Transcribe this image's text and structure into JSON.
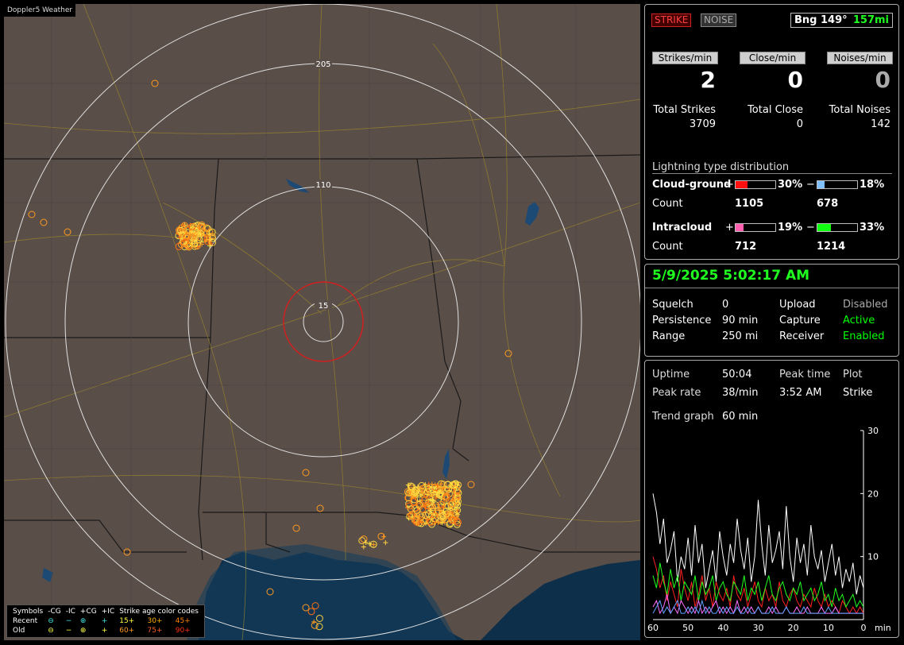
{
  "app": {
    "title": "Doppler5 Weather"
  },
  "map": {
    "ring_labels": [
      "205",
      "110",
      "15"
    ],
    "legend": {
      "symbols_label": "Symbols",
      "headers": [
        "-CG",
        "-IC",
        "+CG",
        "+IC"
      ],
      "age_label": "Strike age color codes",
      "recent_label": "Recent",
      "old_label": "Old",
      "recent_symbols": [
        "⊖",
        "−",
        "⊕",
        "+"
      ],
      "old_symbols": [
        "⊖",
        "−",
        "⊕",
        "+"
      ],
      "recent_ages": [
        "15+",
        "30+",
        "45+"
      ],
      "old_ages": [
        "60+",
        "75+",
        "90+"
      ],
      "age_colors": [
        "#ffff40",
        "#ffb000",
        "#ff8000"
      ]
    },
    "colors": {
      "land": "#5a4e48",
      "water": "#0e2f4a",
      "rings": "#e0e0e0",
      "close_ring": "#d02020",
      "roads": "#a08a2a",
      "borders": "#1a1a1a",
      "strike_orange": "#ff9a20",
      "strike_yellow": "#ffe040"
    }
  },
  "status": {
    "strike_btn": "STRIKE",
    "noise_btn": "NOISE",
    "bearing": "Bng 149°",
    "distance": "157mi",
    "headers": {
      "strikes": "Strikes/min",
      "close": "Close/min",
      "noises": "Noises/min"
    },
    "rates": {
      "strikes": "2",
      "close": "0",
      "noises": "0"
    },
    "totals_labels": {
      "strikes": "Total Strikes",
      "close": "Total Close",
      "noises": "Total Noises"
    },
    "totals": {
      "strikes": "3709",
      "close": "0",
      "noises": "142"
    }
  },
  "distribution": {
    "title": "Lightning type distribution",
    "cg_label": "Cloud-ground",
    "ic_label": "Intracloud",
    "count_label": "Count",
    "plus": "+",
    "minus": "−",
    "cg_pos_pct": "30%",
    "cg_neg_pct": "18%",
    "ic_pos_pct": "19%",
    "ic_neg_pct": "33%",
    "cg_pos_fraction": 0.3,
    "cg_neg_fraction": 0.18,
    "ic_pos_fraction": 0.19,
    "ic_neg_fraction": 0.33,
    "cg_pos_count": "1105",
    "cg_neg_count": "678",
    "ic_pos_count": "712",
    "ic_neg_count": "1214",
    "colors": {
      "cg_pos": "#ff1010",
      "cg_neg": "#80c0ff",
      "ic_pos": "#ff60b0",
      "ic_neg": "#10ff10"
    }
  },
  "settings": {
    "datetime": "5/9/2025 5:02:17 AM",
    "squelch_label": "Squelch",
    "squelch": "0",
    "persistence_label": "Persistence",
    "persistence": "90 min",
    "range_label": "Range",
    "range": "250 mi",
    "upload_label": "Upload",
    "upload": "Disabled",
    "capture_label": "Capture",
    "capture": "Active",
    "receiver_label": "Receiver",
    "receiver": "Enabled"
  },
  "stats": {
    "uptime_label": "Uptime",
    "uptime": "50:04",
    "peak_time_label": "Peak time",
    "peak_time": "3:52 AM",
    "plot_label": "Plot",
    "plot": "Strike",
    "peak_rate_label": "Peak rate",
    "peak_rate": "38/min",
    "trend_label": "Trend graph",
    "trend": "60 min"
  },
  "chart_data": {
    "type": "line",
    "x_ticks": [
      "60",
      "50",
      "40",
      "30",
      "20",
      "10",
      "0"
    ],
    "x_unit": "min",
    "y_ticks": [
      "30",
      "20",
      "10"
    ],
    "ylim": [
      0,
      30
    ],
    "xlim": [
      60,
      0
    ],
    "series": [
      {
        "color": "#ffffff",
        "values": [
          20,
          17,
          12,
          16,
          9,
          11,
          14,
          6,
          10,
          8,
          13,
          7,
          15,
          9,
          12,
          5,
          8,
          11,
          6,
          14,
          10,
          7,
          12,
          9,
          16,
          11,
          8,
          13,
          6,
          10,
          19,
          12,
          7,
          15,
          9,
          11,
          14,
          8,
          18,
          10,
          6,
          13,
          9,
          12,
          7,
          15,
          10,
          8,
          11,
          6,
          9,
          12,
          7,
          10,
          5,
          8,
          6,
          9,
          4,
          7,
          5
        ]
      },
      {
        "color": "#ff2020",
        "values": [
          10,
          8,
          5,
          7,
          3,
          6,
          4,
          2,
          8,
          5,
          3,
          6,
          2,
          4,
          7,
          3,
          5,
          2,
          6,
          4,
          3,
          5,
          2,
          7,
          4,
          3,
          5,
          2,
          4,
          6,
          3,
          2,
          5,
          3,
          4,
          2,
          6,
          3,
          2,
          4,
          5,
          3,
          2,
          4,
          3,
          2,
          5,
          3,
          2,
          4,
          2,
          3,
          2,
          1,
          3,
          2,
          1,
          2,
          1,
          2,
          1
        ]
      },
      {
        "color": "#20ff20",
        "values": [
          7,
          5,
          9,
          6,
          4,
          8,
          5,
          7,
          3,
          6,
          5,
          4,
          7,
          3,
          6,
          4,
          5,
          7,
          3,
          5,
          6,
          4,
          3,
          6,
          5,
          4,
          7,
          3,
          5,
          4,
          6,
          3,
          5,
          7,
          4,
          3,
          5,
          6,
          4,
          3,
          5,
          4,
          6,
          3,
          4,
          5,
          3,
          4,
          6,
          3,
          4,
          2,
          5,
          3,
          4,
          2,
          3,
          4,
          2,
          3,
          2
        ]
      },
      {
        "color": "#ff70ff",
        "values": [
          2,
          3,
          1,
          2,
          4,
          1,
          2,
          1,
          3,
          2,
          1,
          2,
          1,
          3,
          1,
          2,
          1,
          2,
          3,
          1,
          2,
          1,
          2,
          1,
          3,
          1,
          2,
          1,
          2,
          1,
          2,
          1,
          1,
          2,
          1,
          2,
          1,
          1,
          2,
          1,
          1,
          2,
          1,
          1,
          2,
          1,
          1,
          1,
          2,
          1,
          1,
          1,
          2,
          1,
          1,
          1,
          1,
          1,
          1,
          1,
          1
        ]
      },
      {
        "color": "#60a0ff",
        "values": [
          1,
          2,
          3,
          1,
          2,
          1,
          2,
          3,
          1,
          1,
          2,
          1,
          2,
          1,
          3,
          1,
          2,
          1,
          1,
          2,
          1,
          2,
          1,
          1,
          2,
          1,
          1,
          2,
          1,
          1,
          2,
          1,
          1,
          1,
          2,
          1,
          1,
          1,
          2,
          1,
          1,
          1,
          1,
          2,
          1,
          1,
          1,
          1,
          1,
          1,
          2,
          1,
          1,
          1,
          1,
          1,
          1,
          1,
          1,
          1,
          1
        ]
      }
    ]
  }
}
